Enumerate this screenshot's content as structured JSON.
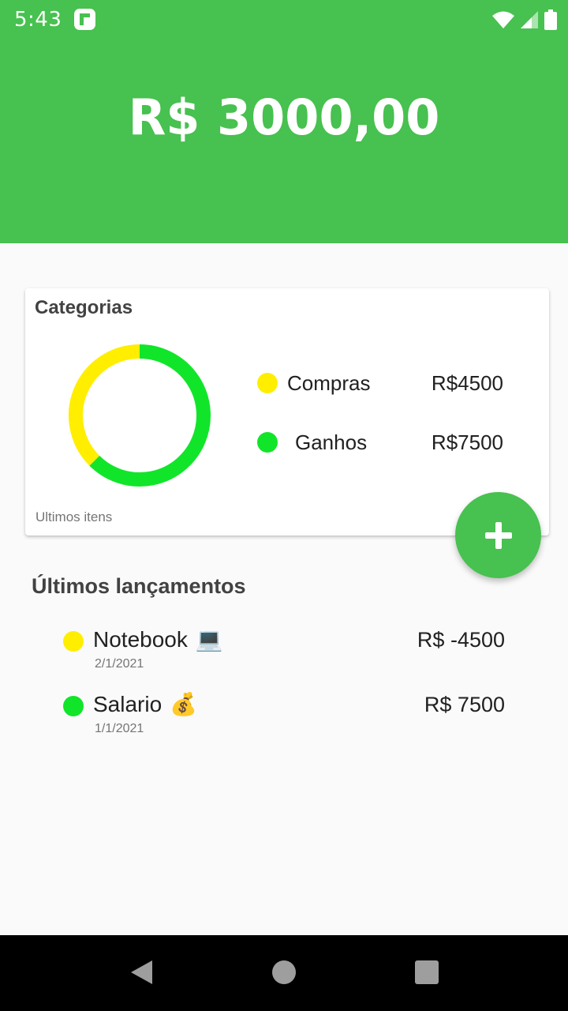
{
  "status_bar": {
    "time": "5:43",
    "icons": [
      "app-notification-icon",
      "wifi-icon",
      "cellular-signal-icon",
      "battery-icon"
    ]
  },
  "header": {
    "balance": "R$ 3000,00",
    "color": "#47c14f"
  },
  "categories_card": {
    "title": "Categorias",
    "footer_text": "Ultimos itens",
    "legend": [
      {
        "label": "Compras",
        "value": "R$4500",
        "color": "#ffee00"
      },
      {
        "label": "Ganhos",
        "value": "R$7500",
        "color": "#11e52a"
      }
    ],
    "chart_data": {
      "type": "pie",
      "style": "donut",
      "categories": [
        "Compras",
        "Ganhos"
      ],
      "values": [
        4500,
        7500
      ],
      "colors": [
        "#ffee00",
        "#11e52a"
      ]
    }
  },
  "fab": {
    "icon": "plus-icon"
  },
  "recent": {
    "title": "Últimos lançamentos",
    "items": [
      {
        "name": "Notebook",
        "emoji": "💻",
        "date": "2/1/2021",
        "amount": "R$ -4500",
        "color": "#ffee00"
      },
      {
        "name": "Salario",
        "emoji": "💰",
        "date": "1/1/2021",
        "amount": "R$ 7500",
        "color": "#11e52a"
      }
    ]
  },
  "nav_bar": {
    "buttons": [
      "back-icon",
      "home-icon",
      "recents-icon"
    ]
  }
}
